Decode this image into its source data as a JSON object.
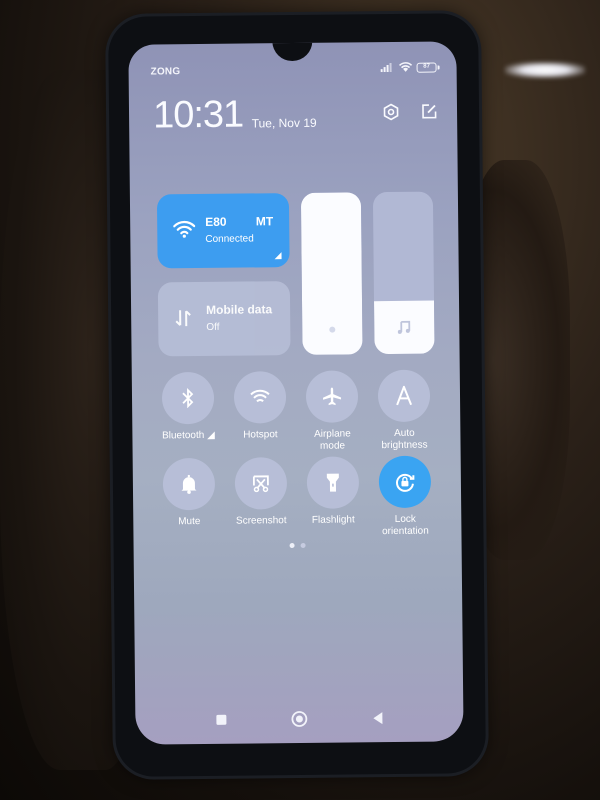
{
  "status_bar": {
    "carrier": "ZONG",
    "battery_level": "87",
    "icons": [
      "signal-icon",
      "wifi-icon",
      "battery-icon"
    ]
  },
  "header": {
    "time": "10:31",
    "date": "Tue, Nov 19",
    "actions": [
      {
        "name": "settings-icon",
        "label": "Settings"
      },
      {
        "name": "edit-icon",
        "label": "Edit"
      }
    ]
  },
  "tiles": {
    "wifi": {
      "title": "E80",
      "title_right": "MT",
      "status": "Connected",
      "active": true,
      "icon": "wifi-icon"
    },
    "mobile_data": {
      "title": "Mobile data",
      "status": "Off",
      "active": false,
      "icon": "mobile-data-icon"
    }
  },
  "sliders": {
    "brightness": {
      "level_percent": 100,
      "icon": "brightness-icon"
    },
    "volume": {
      "level_percent": 33,
      "icon": "music-note-icon"
    }
  },
  "toggles": [
    {
      "label": "Bluetooth ◢",
      "icon": "bluetooth-icon",
      "active": false
    },
    {
      "label": "Hotspot",
      "icon": "hotspot-icon",
      "active": false
    },
    {
      "label": "Airplane mode",
      "icon": "airplane-icon",
      "active": false
    },
    {
      "label": "Auto brightness",
      "icon": "auto-brightness-icon",
      "active": false
    },
    {
      "label": "Mute",
      "icon": "bell-icon",
      "active": false
    },
    {
      "label": "Screenshot",
      "icon": "screenshot-icon",
      "active": false
    },
    {
      "label": "Flashlight",
      "icon": "flashlight-icon",
      "active": false
    },
    {
      "label": "Lock orientation",
      "icon": "lock-rotation-icon",
      "active": true
    }
  ],
  "pagination": {
    "current": 1,
    "total": 2
  },
  "nav_bar": [
    "recents-button",
    "home-button",
    "back-button"
  ],
  "colors": {
    "accent": "#3d9df0",
    "tile_inactive": "#b7bed7"
  }
}
